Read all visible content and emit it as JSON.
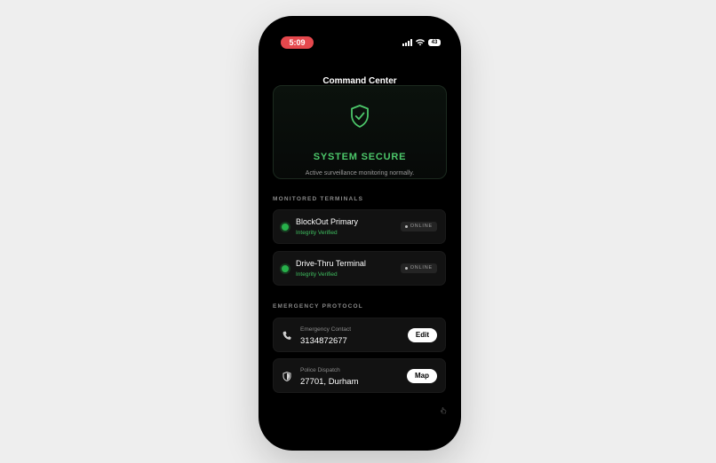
{
  "status_bar": {
    "time": "5:09",
    "battery": "43",
    "icons": [
      "signal-icon",
      "wifi-icon",
      "battery-icon"
    ]
  },
  "header": {
    "title": "Command Center"
  },
  "hero": {
    "icon": "shield-check-icon",
    "title": "SYSTEM SECURE",
    "subtitle": "Active surveillance monitoring normally."
  },
  "terminals": {
    "section_label": "MONITORED TERMINALS",
    "items": [
      {
        "name": "BlockOut Primary",
        "status_text": "Integrity Verified",
        "badge": "ONLINE"
      },
      {
        "name": "Drive-Thru Terminal",
        "status_text": "Integrity Verified",
        "badge": "ONLINE"
      }
    ]
  },
  "emergency": {
    "section_label": "EMERGENCY PROTOCOL",
    "items": [
      {
        "icon": "phone-icon",
        "label": "Emergency Contact",
        "value": "3134872677",
        "button": "Edit"
      },
      {
        "icon": "shield-icon",
        "label": "Police Dispatch",
        "value": "27701, Durham",
        "button": "Map"
      }
    ]
  },
  "colors": {
    "accent_green": "#4cc76a",
    "status_red": "#e5484d",
    "background": "#000000"
  }
}
